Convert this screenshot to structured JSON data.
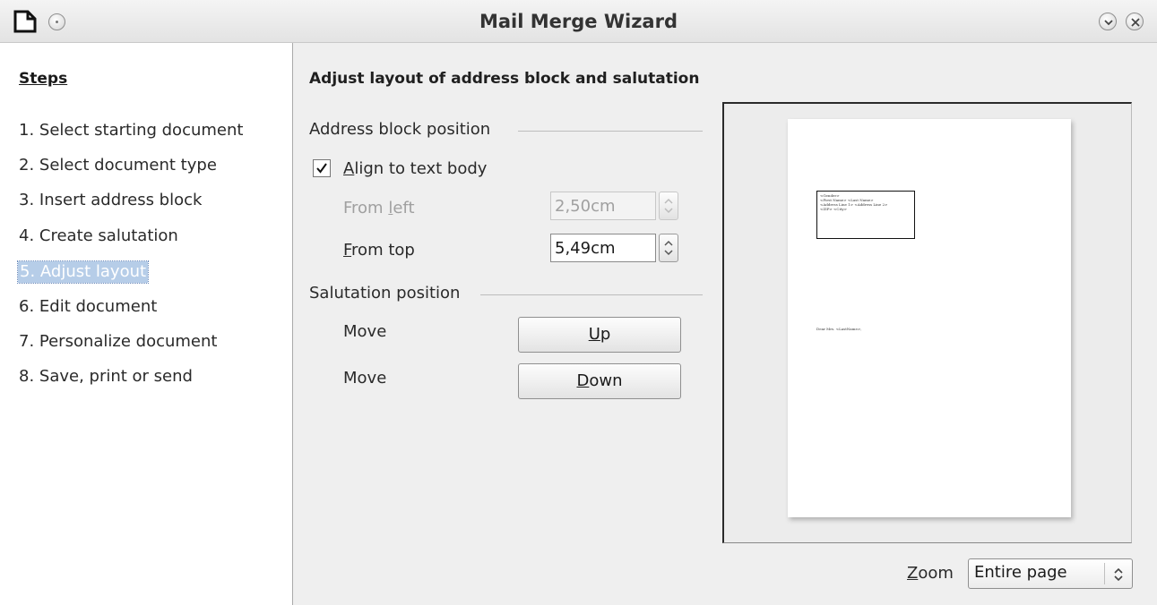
{
  "window": {
    "title": "Mail Merge Wizard",
    "icons": [
      "document-icon",
      "menu-circle-icon",
      "minimize-icon",
      "close-icon"
    ]
  },
  "steps": {
    "header": "Steps",
    "items": [
      {
        "label": "1. Select starting document"
      },
      {
        "label": "2. Select document type"
      },
      {
        "label": "3. Insert address block"
      },
      {
        "label": "4. Create salutation"
      },
      {
        "label": "5. Adjust layout",
        "active": true
      },
      {
        "label": "6. Edit document"
      },
      {
        "label": "7. Personalize document"
      },
      {
        "label": "8. Save, print or send"
      }
    ]
  },
  "main": {
    "title": "Adjust layout of address block and salutation",
    "address_block": {
      "group_label": "Address block position",
      "align_checkbox": {
        "label_mnemonic": "A",
        "label_rest": "lign to text body",
        "checked": true
      },
      "from_left": {
        "label_pre": "From ",
        "label_mnemonic": "l",
        "label_rest": "eft",
        "value": "2,50cm",
        "enabled": false
      },
      "from_top": {
        "label_mnemonic": "F",
        "label_rest": "rom top",
        "value": "5,49cm",
        "enabled": true
      }
    },
    "salutation": {
      "group_label": "Salutation position",
      "move_up": {
        "label": "Move",
        "button_mnemonic": "U",
        "button_rest": "p"
      },
      "move_down": {
        "label": "Move",
        "button_mnemonic": "D",
        "button_rest": "own"
      }
    }
  },
  "preview": {
    "address_lines": [
      "<Gender>",
      "<First Name> <Last Name>",
      "<Address Line 1> <Address Line 2>",
      "<ZIP> <City>"
    ],
    "salutation_text": "Dear Mrs. <LastName>,"
  },
  "zoom": {
    "label_mnemonic": "Z",
    "label_rest": "oom",
    "selected": "Entire page"
  },
  "colors": {
    "active_step_bg": "#b6cde8",
    "panel_bg": "#ffffff",
    "dialog_bg": "#efefef"
  }
}
